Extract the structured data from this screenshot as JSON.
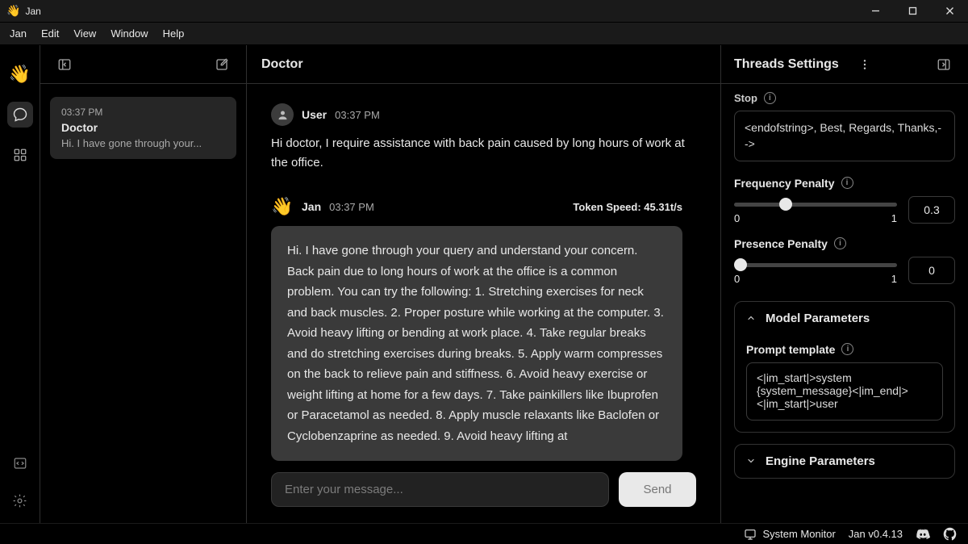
{
  "window": {
    "title": "Jan"
  },
  "menubar": [
    "Jan",
    "Edit",
    "View",
    "Window",
    "Help"
  ],
  "rail": {
    "items": [
      {
        "name": "jan-logo",
        "glyph": "👋"
      },
      {
        "name": "chat-icon"
      },
      {
        "name": "apps-icon"
      }
    ]
  },
  "threads": {
    "current": {
      "time": "03:37 PM",
      "title": "Doctor",
      "preview": "Hi. I have gone through your..."
    }
  },
  "chat": {
    "title": "Doctor",
    "user": {
      "name": "User",
      "time": "03:37 PM",
      "text": "Hi doctor, I require assistance with back pain caused by long hours of work at the office."
    },
    "jan": {
      "name": "Jan",
      "time": "03:37 PM",
      "token_speed": "Token Speed: 45.31t/s",
      "text": "Hi. I have gone through your query and understand your concern. Back pain due to long hours of work at the office is a common problem. You can try the following: 1. Stretching exercises for neck and back muscles. 2. Proper posture while working at the computer. 3. Avoid heavy lifting or bending at work place. 4. Take regular breaks and do stretching exercises during breaks. 5. Apply warm compresses on the back to relieve pain and stiffness. 6. Avoid heavy exercise or weight lifting at home for a few days. 7. Take painkillers like Ibuprofen or Paracetamol as needed. 8. Apply muscle relaxants like Baclofen or Cyclobenzaprine as needed. 9. Avoid heavy lifting at"
    },
    "input_placeholder": "Enter your message...",
    "send_label": "Send"
  },
  "settings": {
    "title": "Threads Settings",
    "stop": {
      "label": "Stop",
      "value": "<endofstring>, Best, Regards, Thanks,-->"
    },
    "freq_penalty": {
      "label": "Frequency Penalty",
      "min": "0",
      "max": "1",
      "value": "0.3",
      "pct": 30
    },
    "pres_penalty": {
      "label": "Presence Penalty",
      "min": "0",
      "max": "1",
      "value": "0",
      "pct": 0
    },
    "model_params": {
      "title": "Model Parameters",
      "prompt_label": "Prompt template",
      "prompt_value": "<|im_start|>system\n{system_message}<|im_end|>\n<|im_start|>user"
    },
    "engine_params": {
      "title": "Engine Parameters"
    }
  },
  "statusbar": {
    "sysmon": "System Monitor",
    "version": "Jan v0.4.13"
  }
}
